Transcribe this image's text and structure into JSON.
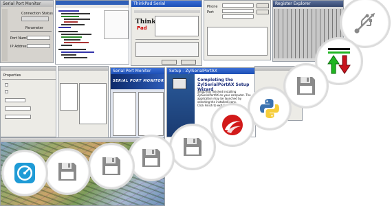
{
  "screenshots": {
    "s1": {
      "title": "Serial Port Monitor",
      "label_status": "Connection Status",
      "label_port": "Port Number",
      "label_ip": "IP Address",
      "label_header": "Parameter"
    },
    "s3": {
      "title": "ThinkPad Serial",
      "brand": "Think",
      "product": "Pad"
    },
    "s4": {
      "label_a": "Phone",
      "label_b": "Port"
    },
    "s5": {
      "title": "Register Explorer"
    },
    "s6": {
      "tab": "Properties"
    },
    "s8": {
      "title": "Serial Port Monitor",
      "brand": "SERIAL PORT MONITOR"
    },
    "s9": {
      "title": "Setup - ZylSerialPortAX",
      "heading": "Completing the ZylSerialPortAX Setup Wizard",
      "body": "Setup has finished installing ZylSerialPortAX on your computer. The application may be launched by selecting the installed icons.",
      "footer": "Click Finish to exit Setup."
    }
  },
  "icons": [
    {
      "name": "usb-icon"
    },
    {
      "name": "transfer-arrows-icon"
    },
    {
      "name": "floppy-disk-icon"
    },
    {
      "name": "python-icon"
    },
    {
      "name": "red-swirl-icon"
    },
    {
      "name": "floppy-disk-icon"
    },
    {
      "name": "floppy-disk-icon"
    },
    {
      "name": "floppy-disk-icon"
    },
    {
      "name": "floppy-disk-icon"
    },
    {
      "name": "speedometer-icon"
    }
  ],
  "colors": {
    "circle_border": "#dcdcdc",
    "icon_gray": "#8a8a8a",
    "xp_title_blue": "#1c4fb5",
    "green_arrow": "#1fb521",
    "red_arrow": "#c8121c",
    "python_blue": "#3a72b0",
    "python_yellow": "#f6cd3a",
    "swirl_red": "#d21a1a",
    "speedometer_blue": "#1f9bd6"
  }
}
